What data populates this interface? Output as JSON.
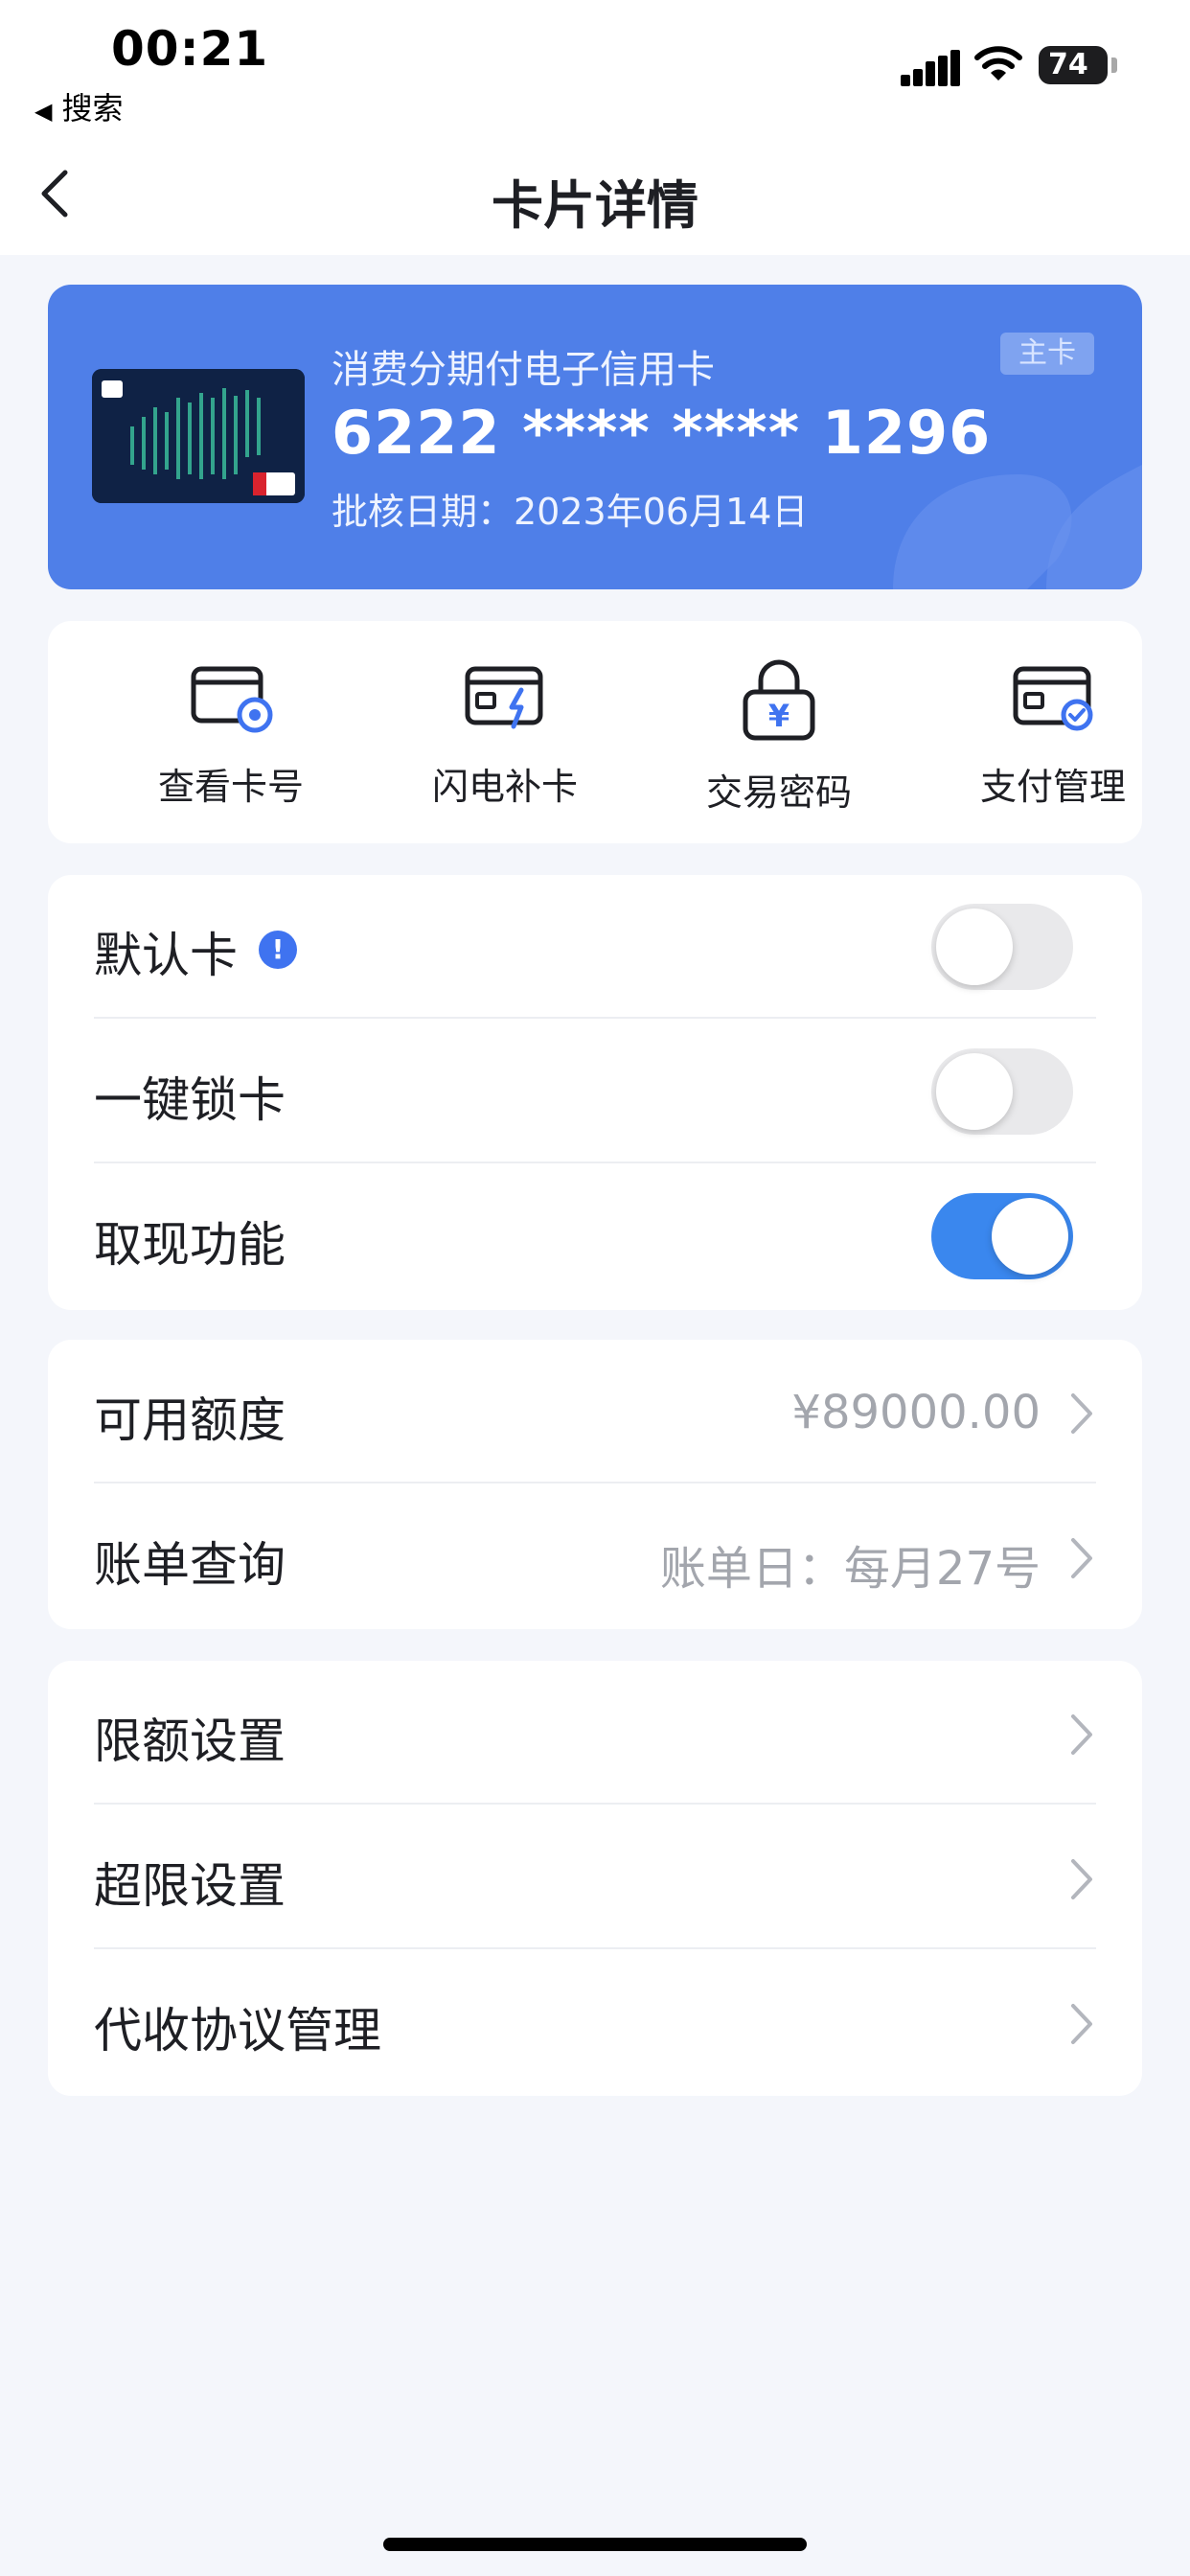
{
  "status_bar": {
    "time": "00:21",
    "back_app": "搜索",
    "battery": "74"
  },
  "nav": {
    "title": "卡片详情"
  },
  "card": {
    "name": "消费分期付电子信用卡",
    "number": "6222 **** **** 1296",
    "approval_date": "批核日期：2023年06月14日",
    "badge": "主卡",
    "bg_color": "#4f7fe8"
  },
  "quick_actions": [
    {
      "label": "查看卡号",
      "icon": "card-view-icon"
    },
    {
      "label": "闪电补卡",
      "icon": "card-lightning-icon"
    },
    {
      "label": "交易密码",
      "icon": "lock-yuan-icon"
    },
    {
      "label": "支付管理",
      "icon": "card-check-icon"
    }
  ],
  "switches": [
    {
      "label": "默认卡",
      "on": false,
      "has_info": true
    },
    {
      "label": "一键锁卡",
      "on": false
    },
    {
      "label": "取现功能",
      "on": true
    }
  ],
  "account": [
    {
      "label": "可用额度",
      "value": "¥89000.00"
    },
    {
      "label": "账单查询",
      "value": "账单日：每月27号"
    }
  ],
  "settings": [
    {
      "label": "限额设置"
    },
    {
      "label": "超限设置"
    },
    {
      "label": "代收协议管理"
    }
  ],
  "colors": {
    "accent": "#3f73f0",
    "toggle_on": "#3a87ee",
    "background": "#f4f6fb"
  }
}
